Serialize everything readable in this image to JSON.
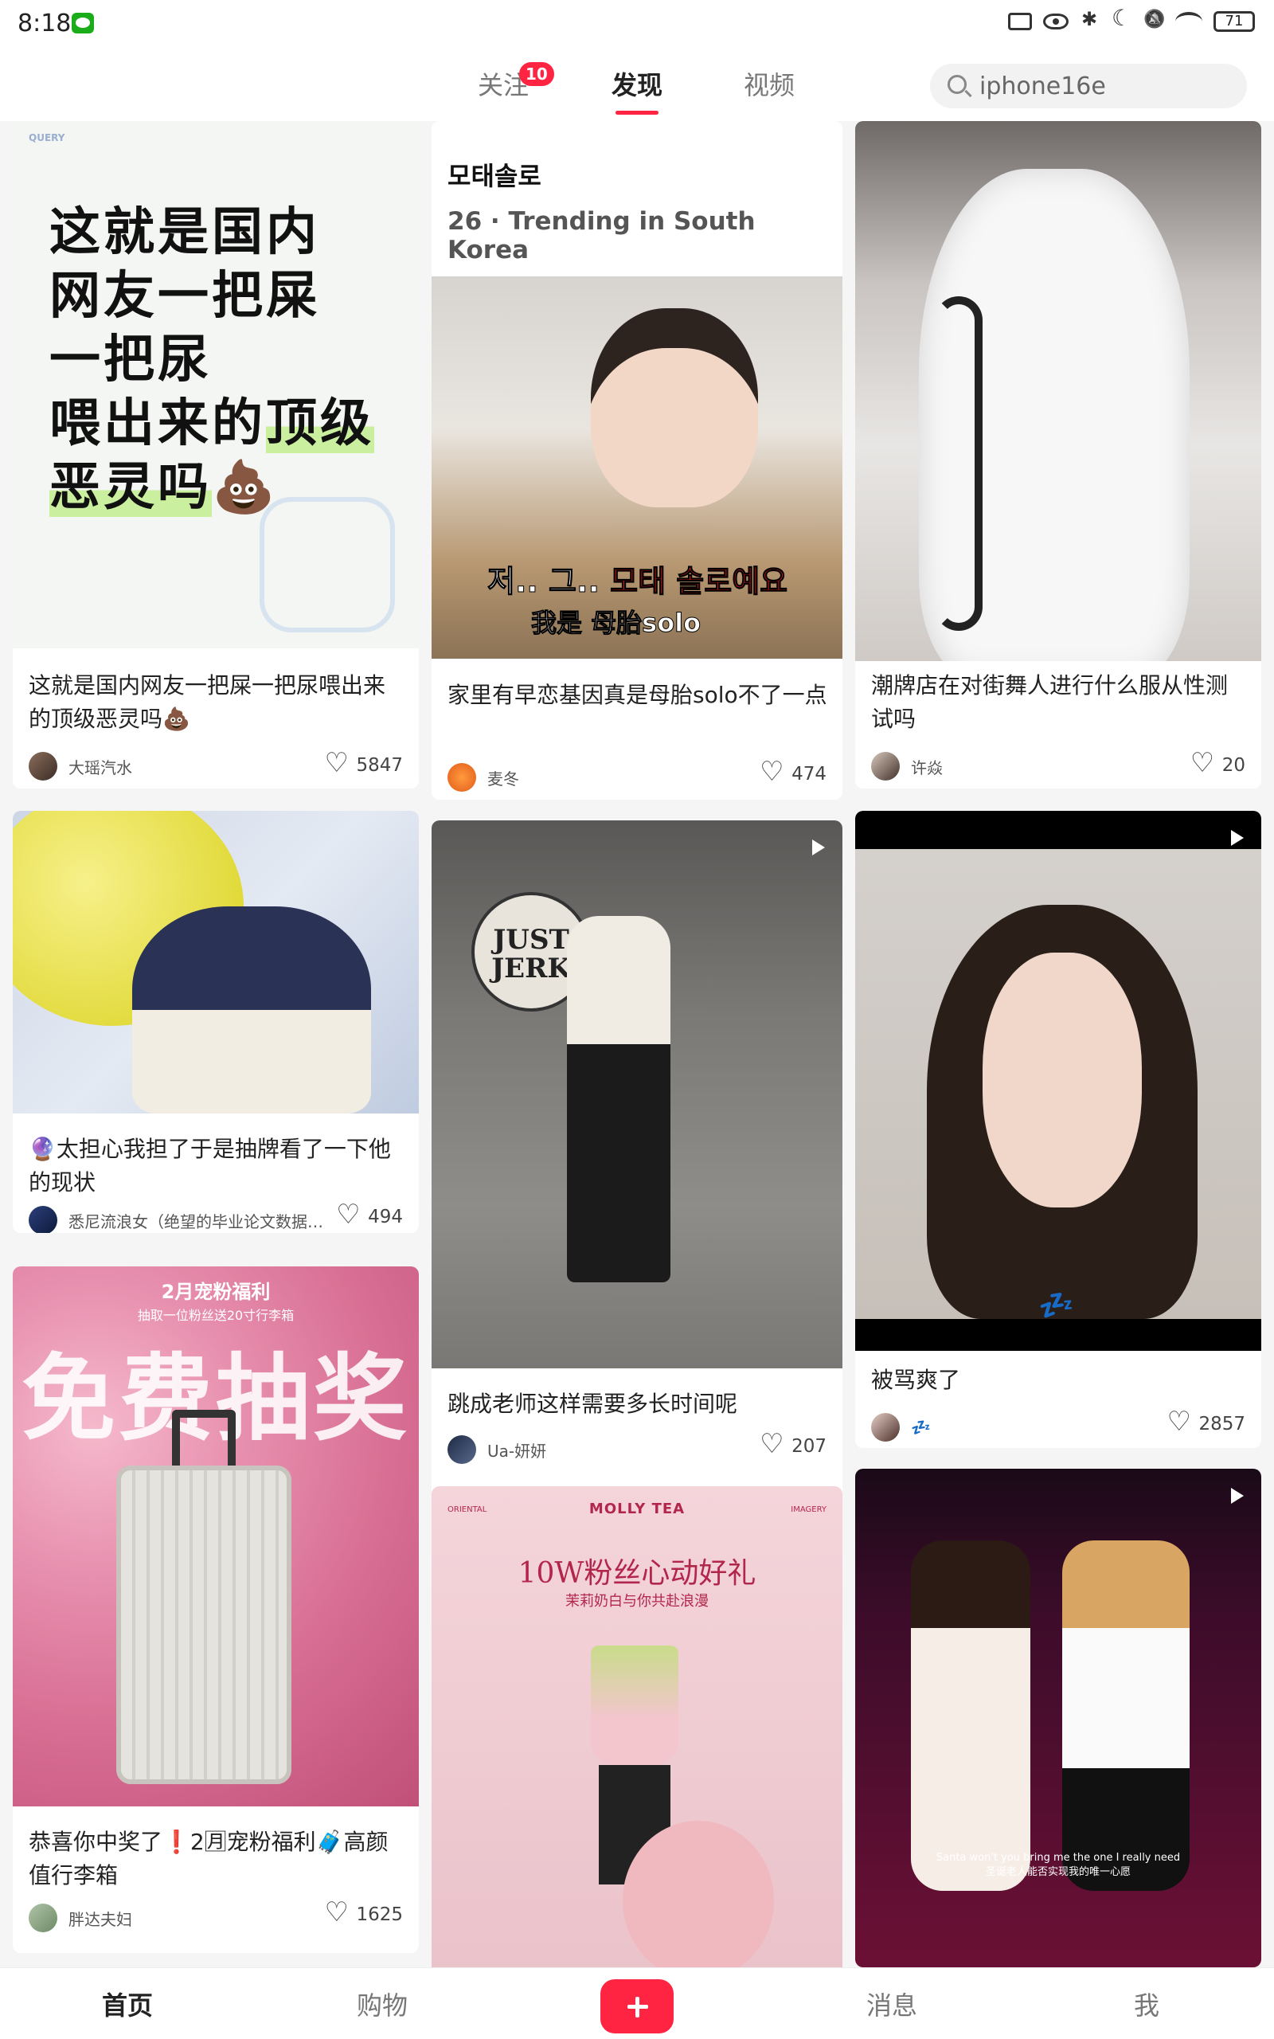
{
  "status_bar": {
    "time": "8:18",
    "battery": "71",
    "icons": [
      "wechat-icon",
      "cast-icon",
      "eye-icon",
      "bluetooth-icon",
      "moon-icon",
      "mute-bell-icon",
      "wifi-icon",
      "battery-icon"
    ]
  },
  "top_nav": {
    "tabs": [
      {
        "label": "关注",
        "badge": "10"
      },
      {
        "label": "发现",
        "active": true
      },
      {
        "label": "视频"
      }
    ],
    "search": {
      "placeholder": "iphone16e"
    }
  },
  "accent_color": "#ff2442",
  "cards": [
    {
      "artwork": {
        "tag": "QUERY",
        "lines": [
          "这就是国内",
          "网友一把屎",
          "一把尿",
          "喂出来的",
          "顶级",
          "恶灵吗"
        ],
        "emoji": "💩"
      },
      "title": "这就是国内网友一把屎一把尿喂出来的顶级恶灵吗💩",
      "author": "大瑶汽水",
      "likes": "5847"
    },
    {
      "header_kr": "모태솔로",
      "header_sub": "26 · Trending in South Korea",
      "subtitle_prefix": "저.. 그.. ",
      "subtitle_red": "모태 솔로예요",
      "subtitle_cn": "我是 母胎solo",
      "title": "家里有早恋基因真是母胎solo不了一点",
      "author": "麦冬",
      "likes": "474"
    },
    {
      "title": "潮牌店在对街舞人进行什么服从性测试吗",
      "author": "许焱",
      "likes": "20"
    },
    {
      "title": "🔮太担心我担了于是抽牌看了一下他的现状",
      "author": "悉尼流浪女（绝望的毕业论文数据版）",
      "likes": "494"
    },
    {
      "logo_lines": [
        "JUST",
        "JERK"
      ],
      "title": "跳成老师这样需要多长时间呢",
      "author": "Ua-妍妍",
      "likes": "207",
      "video": true
    },
    {
      "overlay": "💤",
      "title": "被骂爽了",
      "author": "💤",
      "likes": "2857",
      "video": true
    },
    {
      "banner_top": "2月宠粉福利",
      "banner_sub": "抽取一位粉丝送20寸行李箱",
      "banner_big": "免费抽奖",
      "title": "恭喜你中奖了❗2🈷宠粉福利🧳高颜值行李箱",
      "author": "胖达夫妇",
      "likes": "1625"
    },
    {
      "brand": "MOLLY TEA",
      "corner_left": "ORIENTAL",
      "corner_right": "IMAGERY",
      "headline": "10W粉丝心动好礼",
      "subline": "茉莉奶白与你共赴浪漫"
    },
    {
      "caption_en": "Santa won't you bring me the one I really need",
      "caption_cn": "圣诞老人能否实现我的唯一心愿",
      "video": true
    }
  ],
  "bottom_nav": {
    "items": [
      {
        "label": "首页",
        "active": true
      },
      {
        "label": "购物"
      },
      {
        "label": "+"
      },
      {
        "label": "消息"
      },
      {
        "label": "我"
      }
    ]
  }
}
